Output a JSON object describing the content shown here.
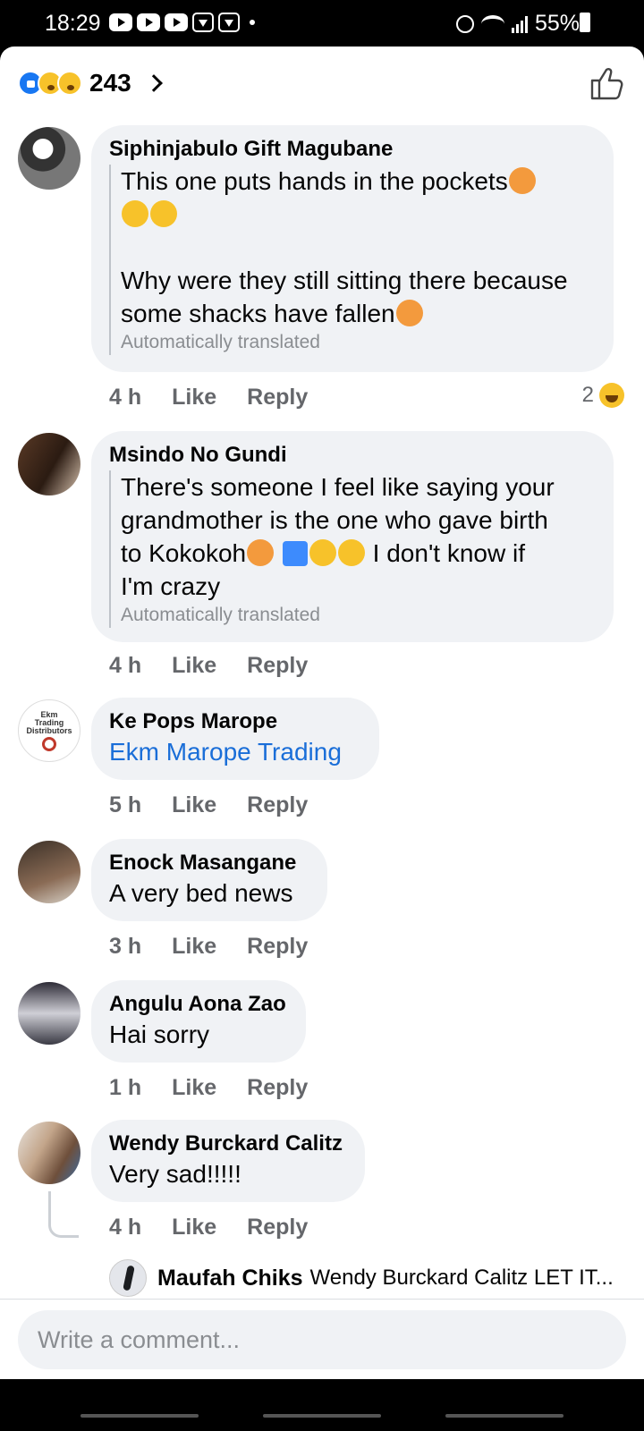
{
  "status_bar": {
    "time": "18:29",
    "battery": "55%"
  },
  "reactions": {
    "count": "243",
    "types": [
      "like",
      "sad",
      "wow"
    ]
  },
  "comments": [
    {
      "author": "Siphinjabulo Gift Magubane",
      "line1": "This one puts hands in the pockets",
      "line2": "Why were they still sitting there because",
      "line3": "some shacks have fallen",
      "translated_note": "Automatically translated",
      "time": "4 h",
      "like": "Like",
      "reply": "Reply",
      "reaction_count": "2"
    },
    {
      "author": "Msindo No Gundi",
      "line1": "There's someone I feel like saying your",
      "line2": "grandmother is the one who gave birth",
      "line3a": "to Kokokoh",
      "line3b": " I don't know if",
      "line4": "I'm crazy",
      "translated_note": "Automatically translated",
      "time": "4 h",
      "like": "Like",
      "reply": "Reply"
    },
    {
      "author": "Ke Pops Marope",
      "text": "Ekm Marope Trading",
      "avatar_text": [
        "Ekm",
        "Trading",
        "Distributors"
      ],
      "time": "5 h",
      "like": "Like",
      "reply": "Reply"
    },
    {
      "author": "Enock Masangane",
      "text": "A very bed news",
      "time": "3 h",
      "like": "Like",
      "reply": "Reply"
    },
    {
      "author": "Angulu Aona Zao",
      "text": "Hai sorry",
      "time": "1 h",
      "like": "Like",
      "reply": "Reply"
    },
    {
      "author": "Wendy Burckard Calitz",
      "text": "Very sad!!!!!",
      "time": "4 h",
      "like": "Like",
      "reply": "Reply"
    }
  ],
  "reply_preview": {
    "author": "Maufah Chiks",
    "text": "Wendy Burckard Calitz LET IT..."
  },
  "composer": {
    "placeholder": "Write a comment..."
  }
}
